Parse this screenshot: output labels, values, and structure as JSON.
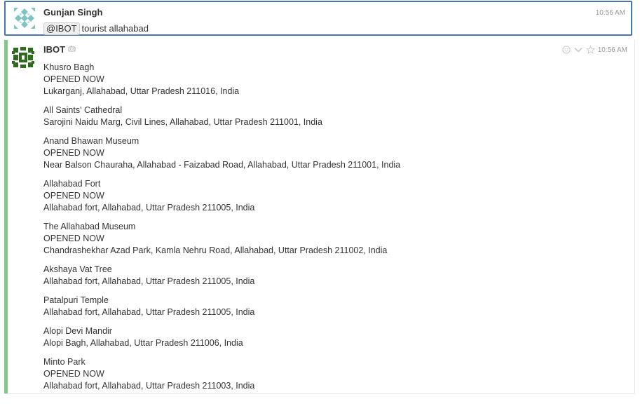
{
  "user_message": {
    "sender": "Gunjan Singh",
    "time": "10:56 AM",
    "mention": "@IBOT",
    "text": "tourist allahabad",
    "avatar_icon": "identicon-avatar-icon"
  },
  "bot_message": {
    "sender": "IBOT",
    "time": "10:56 AM",
    "bot_icon": "bot-icon",
    "avatar_icon": "bot-identicon-avatar-icon",
    "stream_color": "#8ac58e",
    "actions": [
      "emoji-reaction-icon",
      "chevron-down-icon",
      "star-icon"
    ],
    "places": [
      {
        "name": "Khusro Bagh",
        "status": "OPENED NOW",
        "address": "Lukarganj, Allahabad, Uttar Pradesh 211016, India"
      },
      {
        "name": "All Saints' Cathedral",
        "status": "",
        "address": "Sarojini Naidu Marg, Civil Lines, Allahabad, Uttar Pradesh 211001, India"
      },
      {
        "name": "Anand Bhawan Museum",
        "status": "OPENED NOW",
        "address": "Near Balson Chauraha, Allahabad - Faizabad Road, Allahabad, Uttar Pradesh 211001, India"
      },
      {
        "name": "Allahabad Fort",
        "status": "OPENED NOW",
        "address": "Allahabad fort, Allahabad, Uttar Pradesh 211005, India"
      },
      {
        "name": "The Allahabad Museum",
        "status": "OPENED NOW",
        "address": "Chandrashekhar Azad Park, Kamla Nehru Road, Allahabad, Uttar Pradesh 211002, India"
      },
      {
        "name": "Akshaya Vat Tree",
        "status": "",
        "address": "Allahabad fort, Allahabad, Uttar Pradesh 211005, India"
      },
      {
        "name": "Patalpuri Temple",
        "status": "",
        "address": "Allahabad fort, Allahabad, Uttar Pradesh 211005, India"
      },
      {
        "name": "Alopi Devi Mandir",
        "status": "",
        "address": "Alopi Bagh, Allahabad, Uttar Pradesh 211006, India"
      },
      {
        "name": "Minto Park",
        "status": "OPENED NOW",
        "address": "Allahabad fort, Allahabad, Uttar Pradesh 211003, India"
      }
    ]
  },
  "colors": {
    "focus_border": "#4a76a8",
    "text": "#333333",
    "muted": "#999999",
    "user_avatar": "#5fb3b3",
    "bot_avatar": "#2e6b1f"
  }
}
